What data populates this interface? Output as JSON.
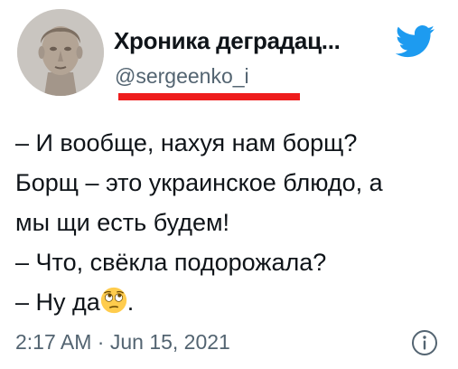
{
  "author": {
    "display_name": "Хроника деградац...",
    "handle": "@sergeenko_i",
    "avatar_icon": "classical-bust-avatar"
  },
  "brand_icon": "twitter-bird-icon",
  "tweet": {
    "lines": [
      "– И вообще, нахуя нам борщ?",
      "Борщ – это украинское блюдо, а",
      "мы щи есть будем!",
      "– Что, свёкла подорожала?",
      "– Ну да"
    ],
    "trailing": ".",
    "emoji": "face-with-rolling-eyes"
  },
  "meta": {
    "time": "2:17 AM",
    "separator": "·",
    "date": "Jun 15, 2021",
    "info_icon": "info-icon"
  },
  "colors": {
    "brand": "#1d9bf0",
    "redline": "#ee1c1c",
    "text": "#0f1419",
    "muted": "#536471"
  }
}
